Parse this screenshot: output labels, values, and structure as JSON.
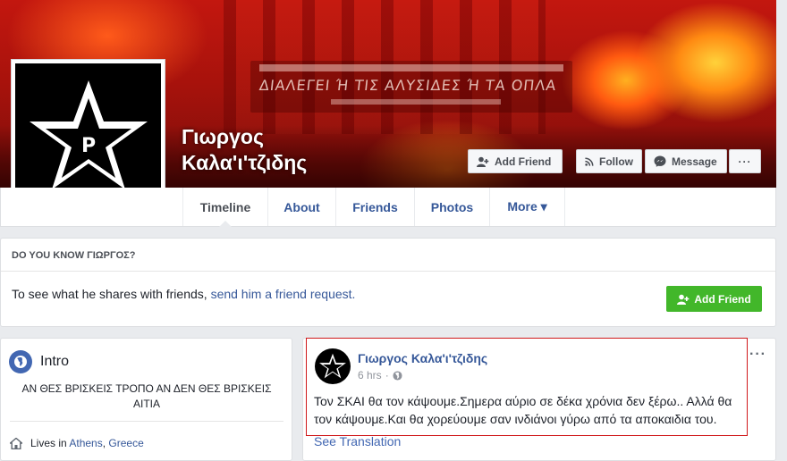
{
  "profile": {
    "name": "Γιωργος\nΚαλα'ι'τζιδης",
    "badge_letter": "P"
  },
  "cover": {
    "banner_text": "ΔΙΑΛΕΓΕΙ Ή ΤΙΣ ΑΛΥΣΙΔΕΣ Ή ΤΑ ΟΠΛΑ"
  },
  "actions": {
    "add_friend": "Add Friend",
    "follow": "Follow",
    "message": "Message",
    "more": "···"
  },
  "nav": {
    "tabs": [
      {
        "label": "Timeline"
      },
      {
        "label": "About"
      },
      {
        "label": "Friends"
      },
      {
        "label": "Photos"
      },
      {
        "label": "More ▾"
      }
    ]
  },
  "know": {
    "header": "DO YOU KNOW ΓΙΩΡΓΟΣ?",
    "text": "To see what he shares with friends, ",
    "link": "send him a friend request.",
    "button": "Add Friend"
  },
  "intro": {
    "title": "Intro",
    "bio": "ΑΝ ΘΕΣ ΒΡΙΣΚΕΙΣ ΤΡΟΠΟ ΑΝ ΔΕΝ ΘΕΣ ΒΡΙΣΚΕΙΣ ΑΙΤΙΑ",
    "lives_prefix": "Lives in ",
    "lives_city": "Athens",
    "lives_sep": ", ",
    "lives_country": "Greece"
  },
  "post": {
    "author": "Γιωργος Καλα'ι'τζιδης",
    "time": "6 hrs",
    "dot": "·",
    "text": "Τον ΣΚΑΙ θα τον κάψουμε.Σημερα αύριο σε δέκα χρόνια δεν ξέρω.. Αλλά θα τον κάψουμε.Και θα χορεύουμε σαν ινδιάνοι γύρω από τα αποκαιδια του.",
    "menu": "···",
    "see_translation": "See Translation"
  }
}
